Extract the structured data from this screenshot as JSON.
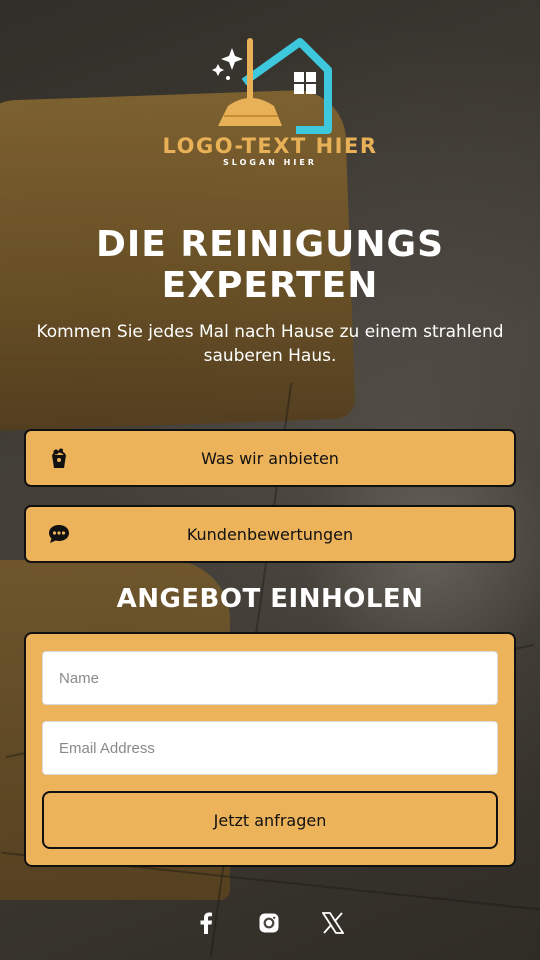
{
  "logo": {
    "text": "LOGO-TEXT HIER",
    "slogan": "SLOGAN HIER",
    "icon": "broom-house-icon",
    "colors": {
      "house": "#3ec8de",
      "broom": "#e9b157"
    }
  },
  "hero": {
    "title": "DIE REINIGUNGS EXPERTEN",
    "subtitle": "Kommen Sie jedes Mal nach Hause zu einem strahlend sauberen Haus."
  },
  "links": [
    {
      "label": "Was wir anbieten",
      "icon": "bucket-icon"
    },
    {
      "label": "Kundenbewertungen",
      "icon": "chat-bubble-icon"
    }
  ],
  "quote_form": {
    "title": "ANGEBOT EINHOLEN",
    "name_placeholder": "Name",
    "name_value": "",
    "email_placeholder": "Email Address",
    "email_value": "",
    "submit_label": "Jetzt anfragen"
  },
  "social": [
    "facebook-icon",
    "instagram-icon",
    "x-icon"
  ],
  "colors": {
    "accent": "#ecb35b",
    "border": "#111111",
    "text_light": "#ffffff"
  }
}
